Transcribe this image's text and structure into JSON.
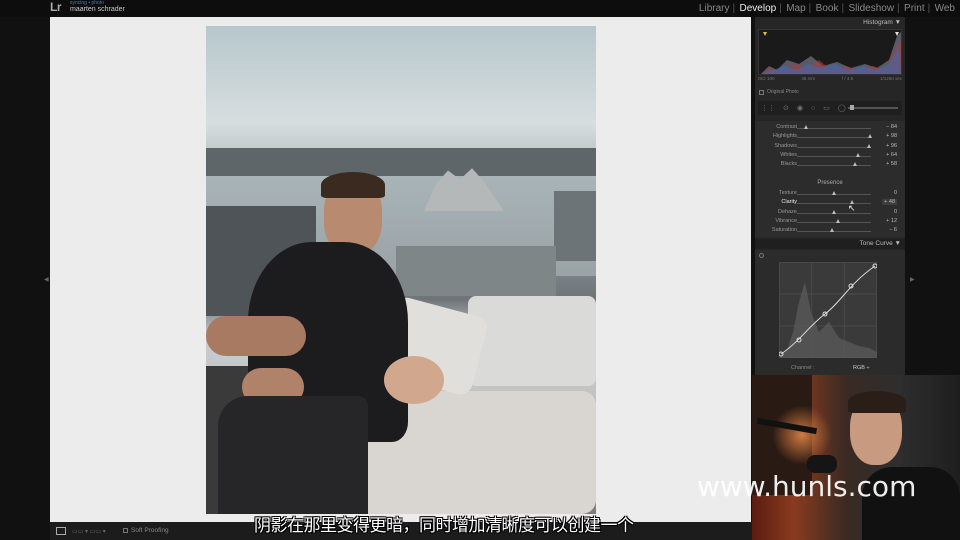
{
  "app": {
    "logo": "Lr",
    "identity_sub": "syncing • photo",
    "identity_name": "maarten schrader"
  },
  "modules": [
    "Library",
    "Develop",
    "Map",
    "Book",
    "Slideshow",
    "Print",
    "Web"
  ],
  "active_module": "Develop",
  "panel": {
    "histogram_title": "Histogram ▼",
    "histogram_info": {
      "iso": "ISO 100",
      "focal": "35 mm",
      "aperture": "f / 4.5",
      "shutter": "1/1250 sec"
    },
    "original_photo_label": "Original Photo",
    "basic_sliders": [
      {
        "label": "Contrast",
        "value": "− 84",
        "pos": 0.12
      },
      {
        "label": "Highlights",
        "value": "+ 98",
        "pos": 0.98
      },
      {
        "label": "Shadows",
        "value": "+ 96",
        "pos": 0.97
      },
      {
        "label": "Whites",
        "value": "+ 64",
        "pos": 0.82
      },
      {
        "label": "Blacks",
        "value": "+ 58",
        "pos": 0.79
      }
    ],
    "presence_title": "Presence",
    "presence_sliders": [
      {
        "label": "Texture",
        "value": "0",
        "pos": 0.5
      },
      {
        "label": "Clarity",
        "value": "+ 48",
        "pos": 0.74,
        "selected": true
      },
      {
        "label": "Dehaze",
        "value": "0",
        "pos": 0.5
      },
      {
        "label": "Vibrance",
        "value": "+ 12",
        "pos": 0.56
      },
      {
        "label": "Saturation",
        "value": "− 6",
        "pos": 0.47
      }
    ],
    "tone_curve_title": "Tone Curve ▼",
    "channel_label": "Channel :",
    "channel_value": "RGB ÷"
  },
  "bottombar": {
    "soft_proofing_label": "Soft Proofing"
  },
  "subtitle": "阴影在那里变得更暗，同时增加清晰度可以创建一个",
  "watermark": "www.hunls.com"
}
